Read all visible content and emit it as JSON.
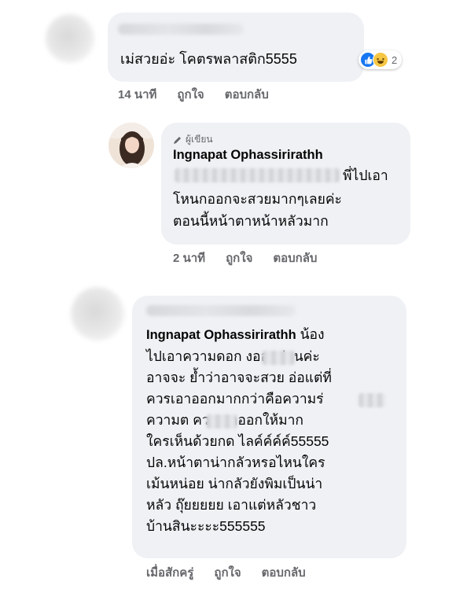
{
  "comment1": {
    "text": "เม่สวยอ่ะ โคตรพลาสติก5555",
    "reactions": {
      "icons": [
        "like-icon",
        "haha-icon"
      ],
      "count": "2"
    },
    "time": "14 นาที",
    "like_label": "ถูกใจ",
    "reply_label": "ตอบกลับ"
  },
  "reply1": {
    "badge_label": "ผู้เขียน",
    "author": "Ingnapat Ophassirirathh",
    "lines": [
      "พี่ไปเอา",
      "โหนกออกจะสวยมากๆเลยค่ะ",
      "ตอนนี้หน้าตาหน้าหลัวมาก"
    ],
    "time": "2 นาที",
    "like_label": "ถูกใจ",
    "reply_label": "ตอบกลับ"
  },
  "comment2": {
    "mention": "Ingnapat Ophassirirathh",
    "line1_rest": "น้อง",
    "lines": [
      "ไปเอาความดอก    งออกก่อนค่ะ",
      "อาจจะ ย้ำว่าอาจจะสวย อ่อแต่ที่",
      "ควรเอาออกมากกว่าคือความร่",
      "ความต    ควรเอาออกให้มาก",
      "ใครเห็นด้วยกด ไลค์ค์ค์ค์55555",
      "ปล.หน้าตาน่ากลัวหรอไหนใคร",
      "เม้นหน่อย น่ากลัวยังพิมเป็นน่า",
      "หลัว ถุ๊ยยยยย เอาแต่หลัวชาว",
      "บ้านสินะะะะ555555"
    ],
    "time": "เมื่อสักครู่",
    "like_label": "ถูกใจ",
    "reply_label": "ตอบกลับ"
  },
  "colors": {
    "bubble": "#eff1f4",
    "meta_text": "#65676b",
    "like_blue": "#1877f2",
    "haha_yellow": "#f7c744"
  }
}
